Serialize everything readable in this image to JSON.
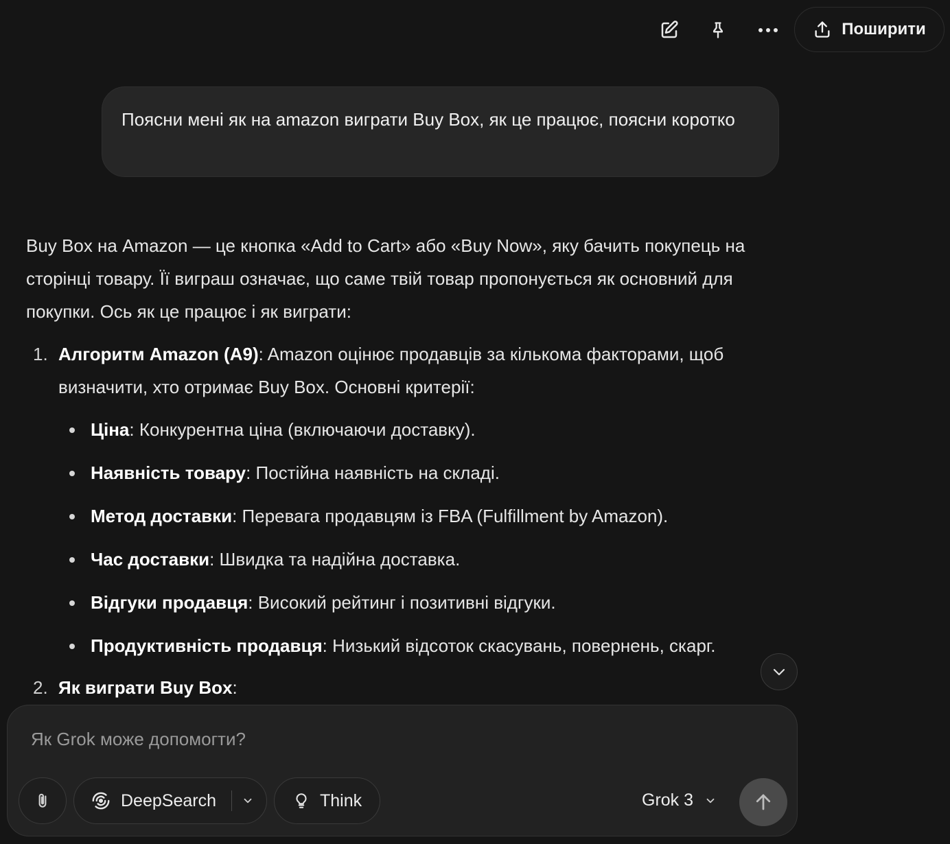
{
  "topbar": {
    "share_label": "Поширити",
    "icons": [
      "edit-icon",
      "pin-icon",
      "more-icon",
      "share-icon"
    ]
  },
  "user_message": "Поясни мені як на amazon виграти Buy Box, як це працює, поясни коротко",
  "answer": {
    "intro": "Buy Box на Amazon — це кнопка «Add to Cart» або «Buy Now», яку бачить покупець на сторінці товару. Її виграш означає, що саме твій товар пропонується як основний для покупки. Ось як це працює і як виграти:",
    "items": [
      {
        "num": "1.",
        "title": "Алгоритм Amazon (A9)",
        "text": ": Amazon оцінює продавців за кількома факторами, щоб визначити, хто отримає Buy Box. Основні критерії:",
        "criteria": [
          {
            "title": "Ціна",
            "text": ": Конкурентна ціна (включаючи доставку)."
          },
          {
            "title": "Наявність товару",
            "text": ": Постійна наявність на складі."
          },
          {
            "title": "Метод доставки",
            "text": ": Перевага продавцям із FBA (Fulfillment by Amazon)."
          },
          {
            "title": "Час доставки",
            "text": ": Швидка та надійна доставка."
          },
          {
            "title": "Відгуки продавця",
            "text": ": Високий рейтинг і позитивні відгуки."
          },
          {
            "title": "Продуктивність продавця",
            "text": ": Низький відсоток скасувань, повернень, скарг."
          }
        ]
      },
      {
        "num": "2.",
        "title": "Як виграти Buy Box",
        "text": ":"
      }
    ]
  },
  "composer": {
    "placeholder": "Як Grok може допомогти?",
    "deepsearch_label": "DeepSearch",
    "think_label": "Think",
    "model_label": "Grok 3"
  },
  "colors": {
    "background": "#151515",
    "bubble": "#262626",
    "composer": "#222222",
    "send_button": "#4a4a4a"
  }
}
